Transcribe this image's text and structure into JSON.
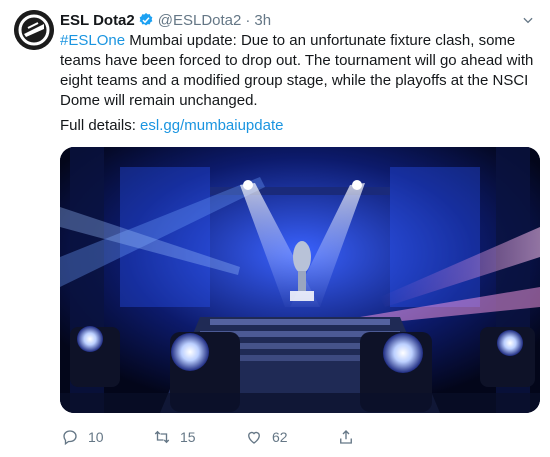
{
  "tweet": {
    "author_name": "ESL Dota2",
    "handle": "@ESLDota2",
    "separator": "·",
    "time": "3h",
    "hashtag": "#ESLOne",
    "text": " Mumbai update: Due to an unfortunate fixture clash, some teams have been forced to drop out. The tournament will go ahead with eight teams and a modified group stage, while the playoffs at the NSCI Dome will remain unchanged.",
    "details_label": "Full details: ",
    "details_link": "esl.gg/mumbaiupdate",
    "media_icon": "stage-photo"
  },
  "actions": {
    "reply_count": "10",
    "retweet_count": "15",
    "like_count": "62"
  },
  "icons": {
    "verified": "verified-badge-icon",
    "caret": "chevron-down-icon",
    "reply": "reply-icon",
    "retweet": "retweet-icon",
    "like": "heart-icon",
    "share": "share-icon"
  },
  "colors": {
    "link": "#1b95e0",
    "secondary": "#657786",
    "verified": "#1da1f2"
  }
}
